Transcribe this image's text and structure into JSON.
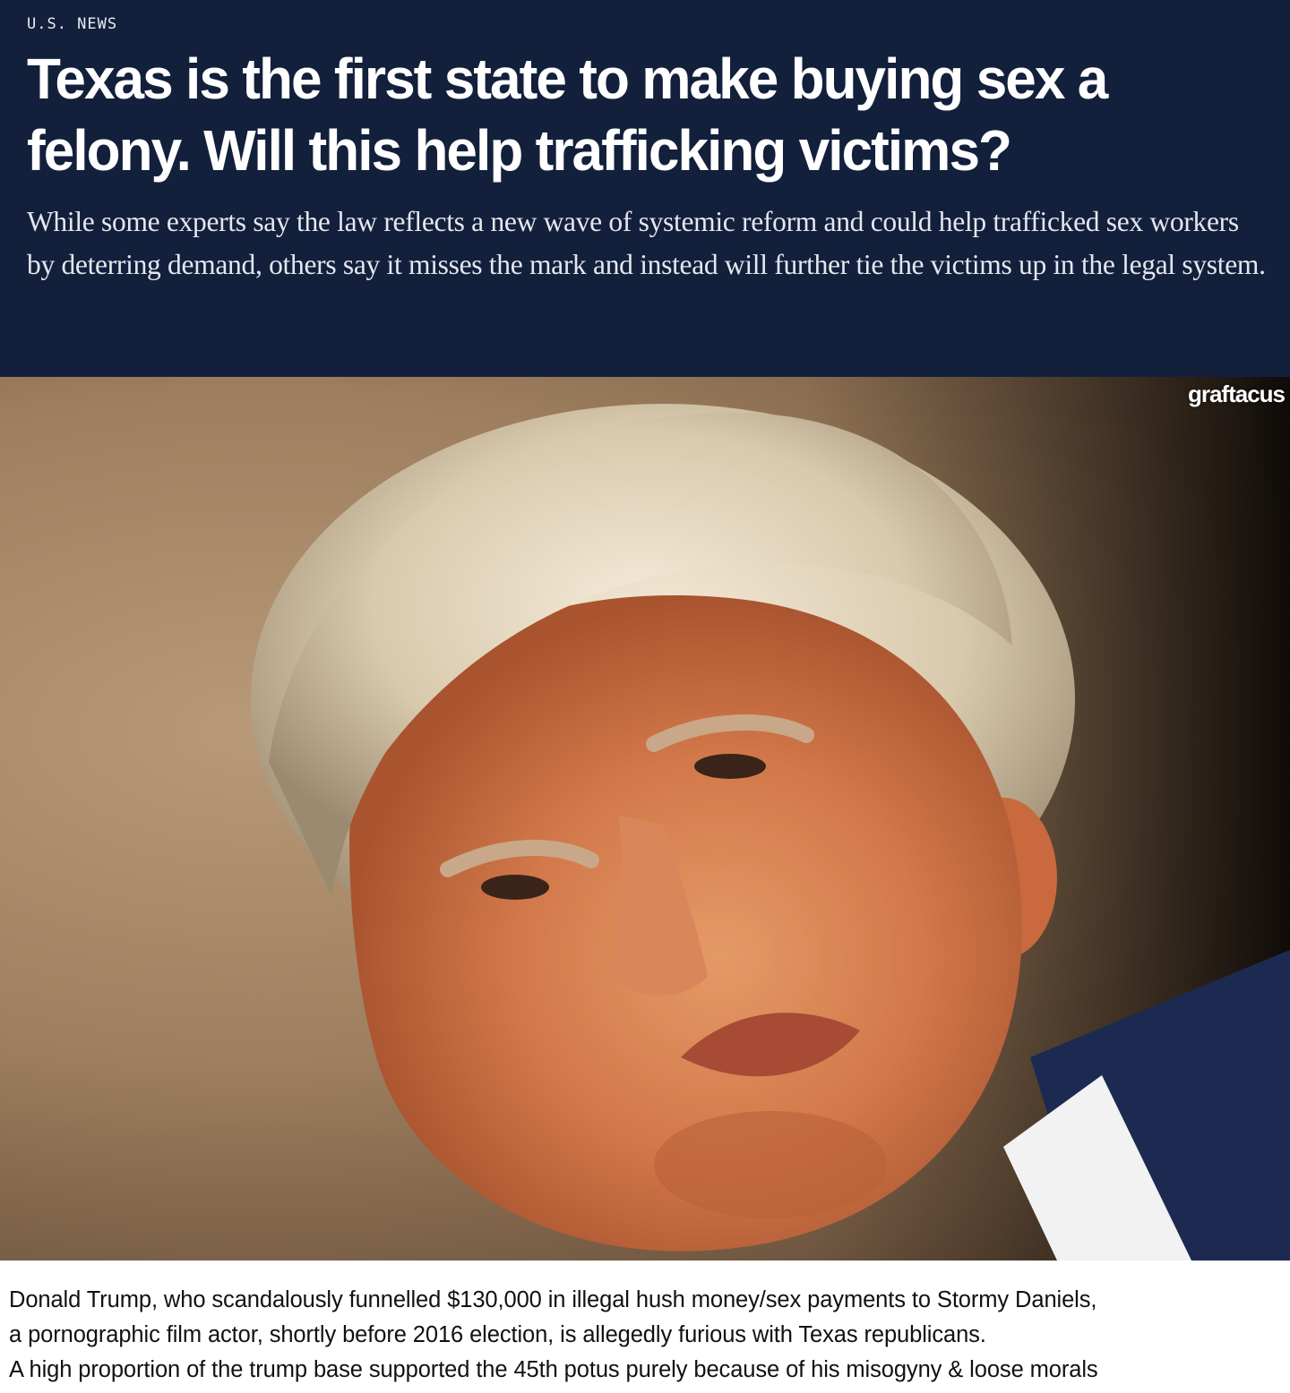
{
  "article": {
    "section": "U.S. NEWS",
    "headline": "Texas is the first state to make buying sex a felony. Will this help trafficking victims?",
    "dek": "While some experts say the law reflects a new wave of systemic reform and could help trafficked sex workers by deterring demand, others say it misses the mark and instead will further tie the victims up in the legal system."
  },
  "photo": {
    "watermark": "graftacus"
  },
  "caption": {
    "lines": [
      "Donald Trump, who scandalously funnelled $130,000 in illegal hush money/sex payments to Stormy Daniels,",
      "a pornographic film actor, shortly before 2016 election, is allegedly furious with Texas republicans.",
      "A high proportion of the trump base supported the 45th potus purely because of his misogyny & loose morals"
    ]
  },
  "colors": {
    "header_bg": "#13203c",
    "header_text": "#ffffff",
    "caption_text": "#111111"
  }
}
